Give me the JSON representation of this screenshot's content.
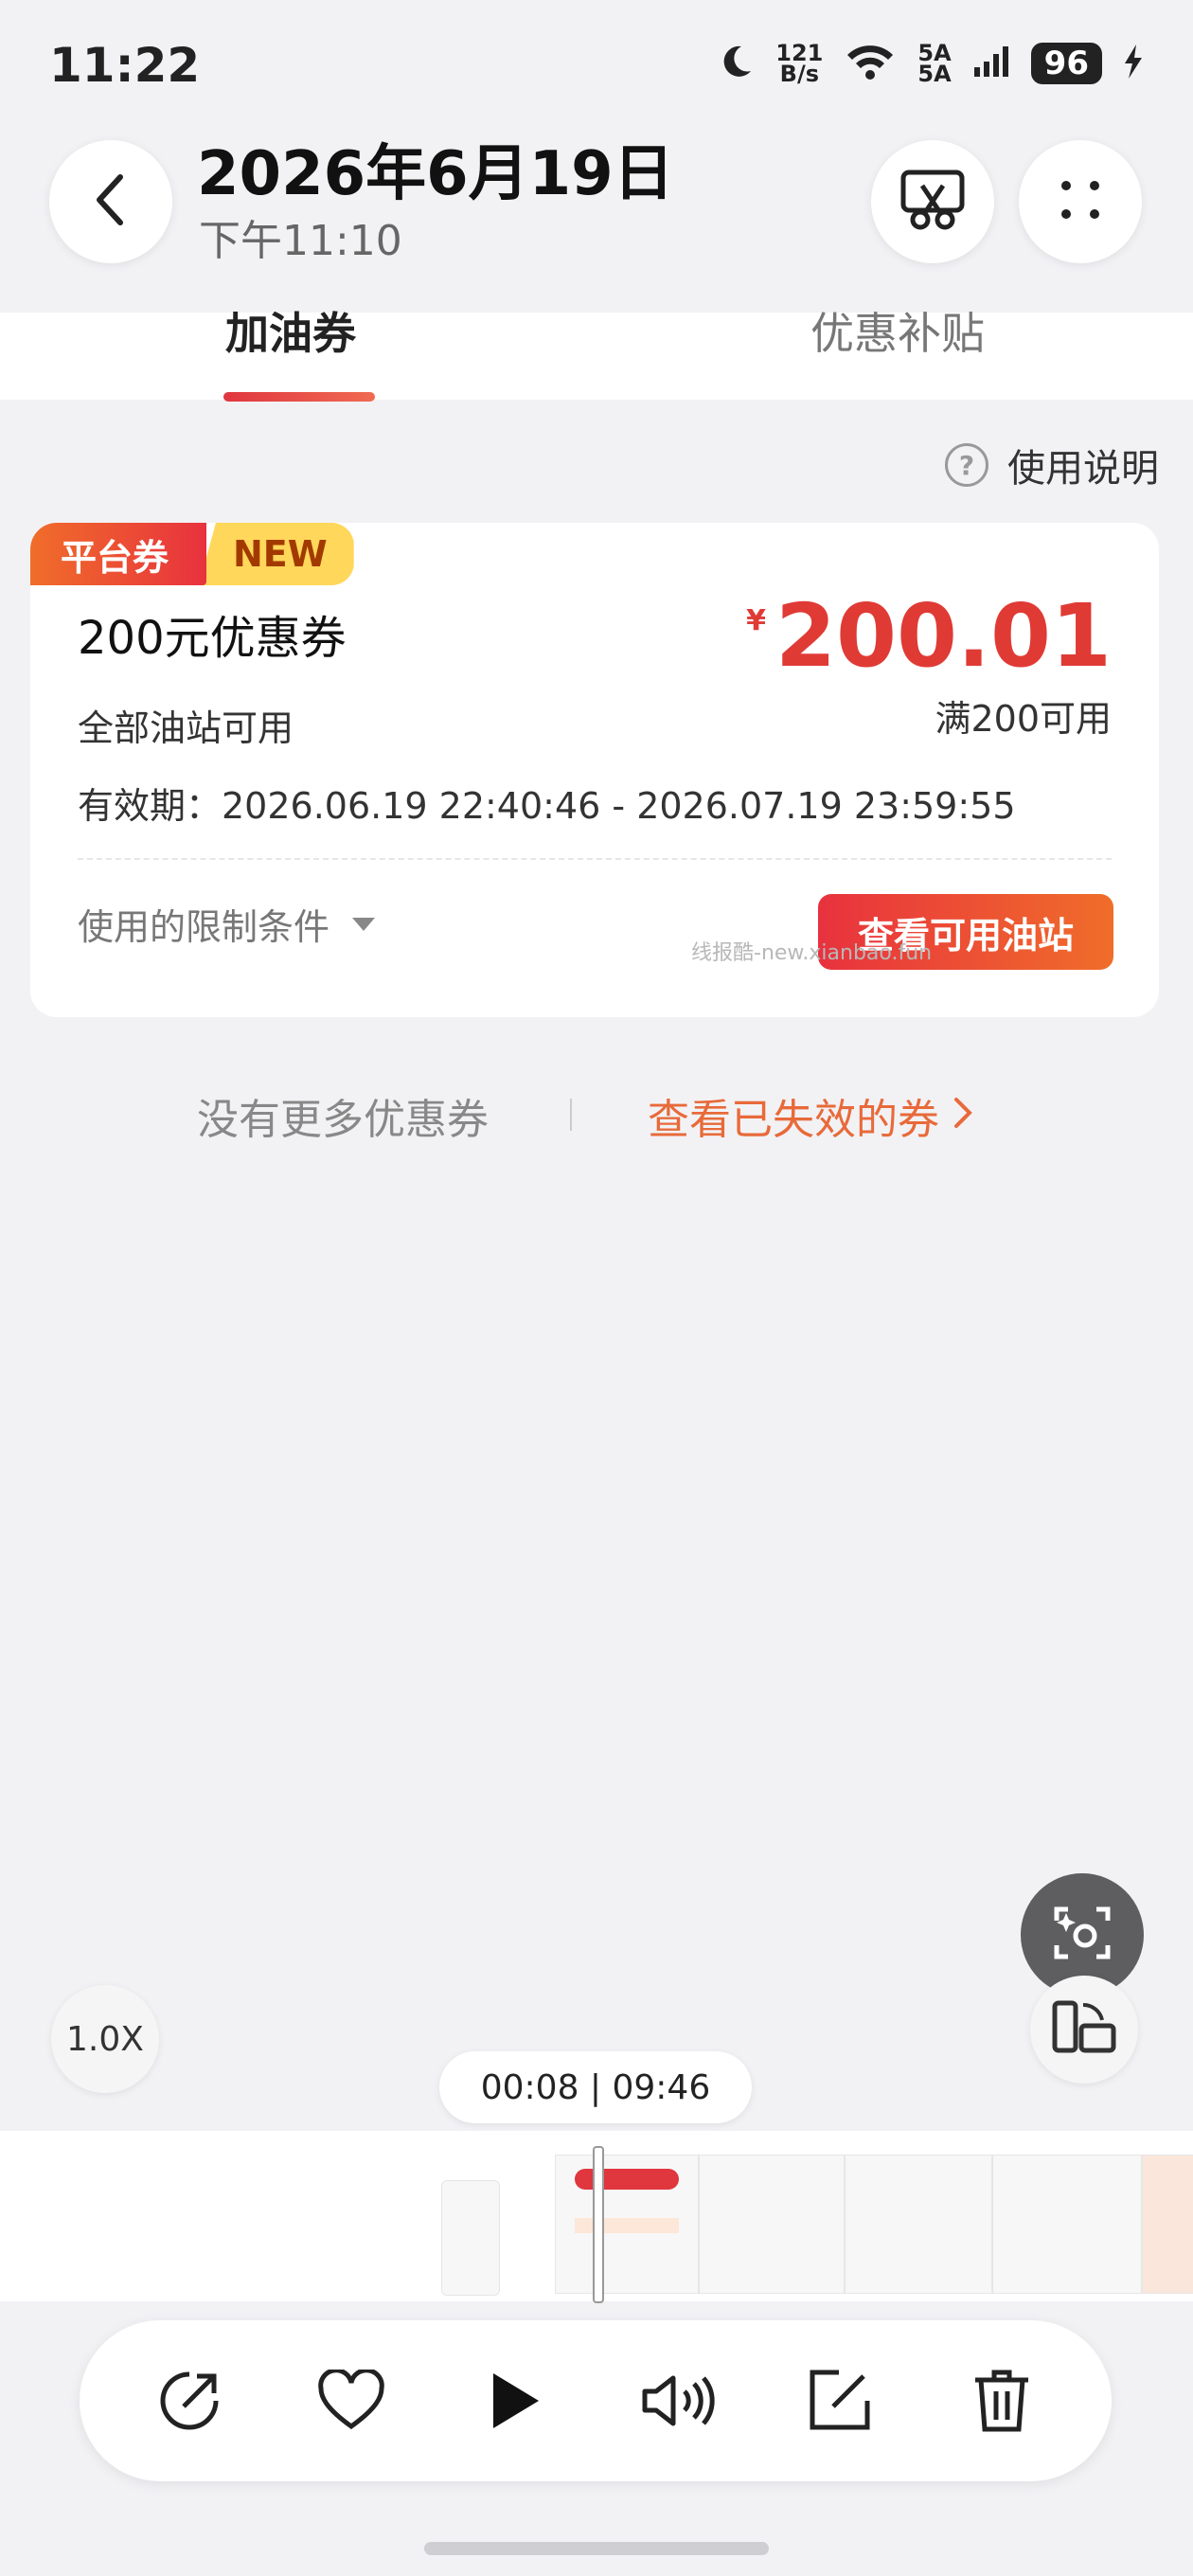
{
  "status_bar": {
    "time": "11:22",
    "net_speed_value": "121",
    "net_speed_unit": "B/s",
    "sim_label_1": "5A",
    "sim_label_2": "5A",
    "battery": "96"
  },
  "header": {
    "date": "2026年6月19日",
    "time": "下午11:10"
  },
  "tabs": [
    {
      "label": "加油券",
      "active": true
    },
    {
      "label": "优惠补贴",
      "active": false
    }
  ],
  "help_label": "使用说明",
  "coupon": {
    "badge_platform": "平台券",
    "badge_new": "NEW",
    "name": "200元优惠券",
    "scope": "全部油站可用",
    "validity": "有效期：2026.06.19 22:40:46 - 2026.07.19 23:59:55",
    "currency": "¥",
    "amount": "200.01",
    "condition": "满200可用",
    "limits_label": "使用的限制条件",
    "button_label": "查看可用油站"
  },
  "watermark": "线报酷-new.xianbao.fun",
  "footer": {
    "no_more": "没有更多优惠券",
    "expired_link": "查看已失效的券"
  },
  "player": {
    "speed": "1.0X",
    "time": "00:08 | 09:46"
  },
  "colors": {
    "accent_red": "#e03a35",
    "accent_orange": "#f06d2a",
    "badge_yellow": "#ffd75a"
  }
}
